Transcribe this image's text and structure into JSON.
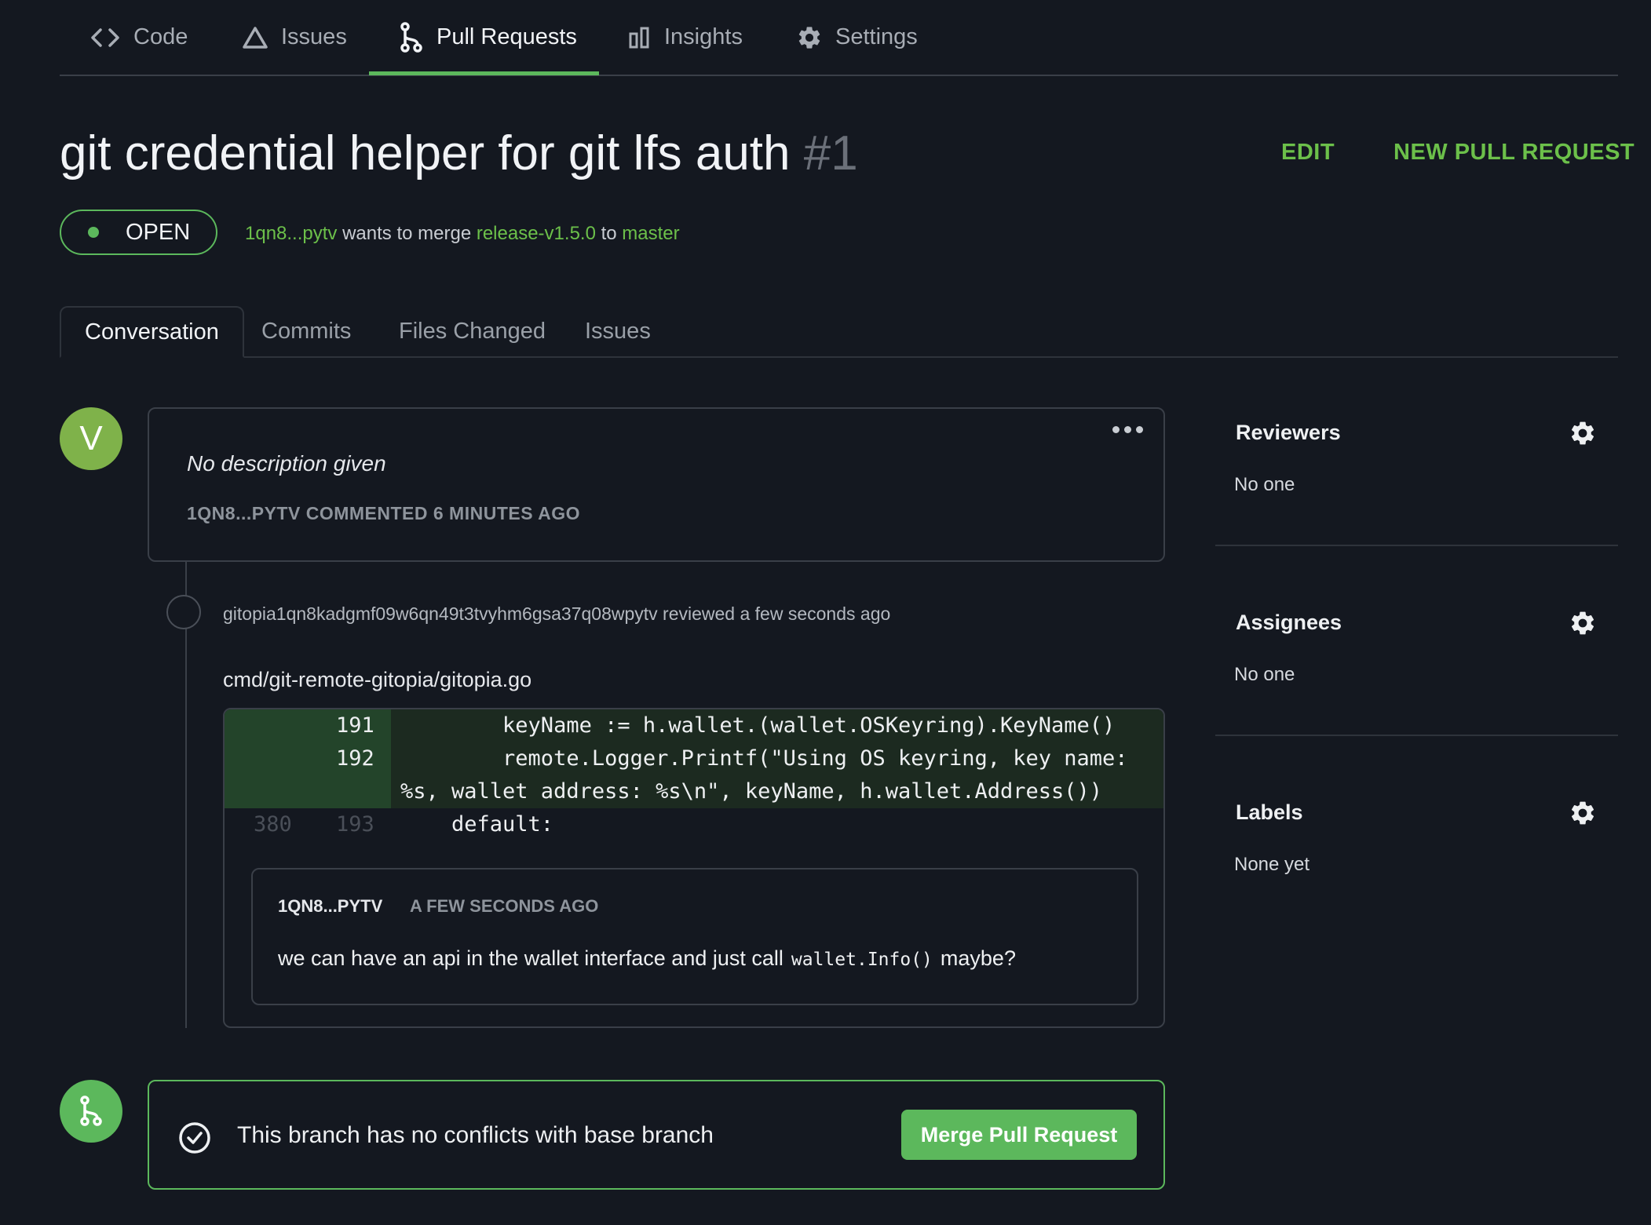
{
  "nav": {
    "items": [
      {
        "label": "Code",
        "icon": "code-icon"
      },
      {
        "label": "Issues",
        "icon": "warning-triangle-icon"
      },
      {
        "label": "Pull Requests",
        "icon": "pull-request-icon",
        "active": true
      },
      {
        "label": "Insights",
        "icon": "insights-bars-icon"
      },
      {
        "label": "Settings",
        "icon": "gear-icon"
      }
    ]
  },
  "pr": {
    "title": "git credential helper for git lfs auth",
    "number": "#1",
    "edit_label": "EDIT",
    "new_pr_label": "NEW PULL REQUEST",
    "status": "OPEN",
    "author": "1qn8...pytv",
    "wants_to_merge": "wants to merge",
    "source_branch": "release-v1.5.0",
    "to_word": "to",
    "target_branch": "master"
  },
  "tabs": [
    "Conversation",
    "Commits",
    "Files Changed",
    "Issues"
  ],
  "description": {
    "avatar_letter": "V",
    "text": "No description given",
    "meta": "1QN8...PYTV COMMENTED 6 MINUTES AGO"
  },
  "review": {
    "text": "gitopia1qn8kadgmf09w6qn49t3tvyhm6gsa37q08wpytv reviewed a few seconds ago",
    "file": "cmd/git-remote-gitopia/gitopia.go",
    "lines": [
      {
        "old": "",
        "new": "191",
        "code": "        keyName := h.wallet.(wallet.OSKeyring).KeyName()"
      },
      {
        "old": "",
        "new": "192",
        "code": "        remote.Logger.Printf(\"Using OS keyring, key name:"
      },
      {
        "old": "",
        "new": "",
        "code": "%s, wallet address: %s\\n\", keyName, h.wallet.Address())"
      },
      {
        "old": "380",
        "new": "193",
        "code": "    default:"
      }
    ],
    "comment": {
      "author": "1QN8...PYTV",
      "time": "A FEW SECONDS AGO",
      "text_before": "we can have an api in the wallet interface and just call",
      "code": "wallet.Info()",
      "text_after": "maybe?"
    }
  },
  "merge": {
    "message": "This branch has no conflicts with base branch",
    "button": "Merge Pull Request"
  },
  "sidebar": {
    "reviewers": {
      "title": "Reviewers",
      "value": "No one"
    },
    "assignees": {
      "title": "Assignees",
      "value": "No one"
    },
    "labels": {
      "title": "Labels",
      "value": "None yet"
    }
  },
  "colors": {
    "accent": "#5cb85c",
    "link": "#6cc04a",
    "background": "#141820",
    "border": "#3a3f48"
  }
}
